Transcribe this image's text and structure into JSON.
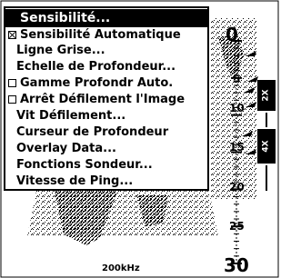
{
  "menu": {
    "items": [
      {
        "label": "Sensibilité...",
        "selected": true,
        "checkbox": false
      },
      {
        "label": "Sensibilité Automatique",
        "checkbox": true,
        "checked": true
      },
      {
        "label": "Ligne Grise...",
        "checkbox": false
      },
      {
        "label": "Echelle de Profondeur...",
        "checkbox": false
      },
      {
        "label": "Gamme Profondr Auto.",
        "checkbox": true,
        "checked": false
      },
      {
        "label": "Arrêt Défilement l'Image",
        "checkbox": true,
        "checked": false
      },
      {
        "label": "Vit Défilement...",
        "checkbox": false
      },
      {
        "label": "Curseur de Profondeur",
        "checkbox": false
      },
      {
        "label": "Overlay Data...",
        "checkbox": false
      },
      {
        "label": "Fonctions Sondeur...",
        "checkbox": false
      },
      {
        "label": "Vitesse de Ping...",
        "checkbox": false
      }
    ]
  },
  "depth_scale": {
    "labels": [
      "0",
      "5",
      "10",
      "15",
      "20",
      "25",
      "30"
    ]
  },
  "frequency": "200kHz",
  "zoom": {
    "top": "2X",
    "bottom": "4X"
  },
  "colors": {
    "background": "#ffffff",
    "foreground": "#000000"
  }
}
